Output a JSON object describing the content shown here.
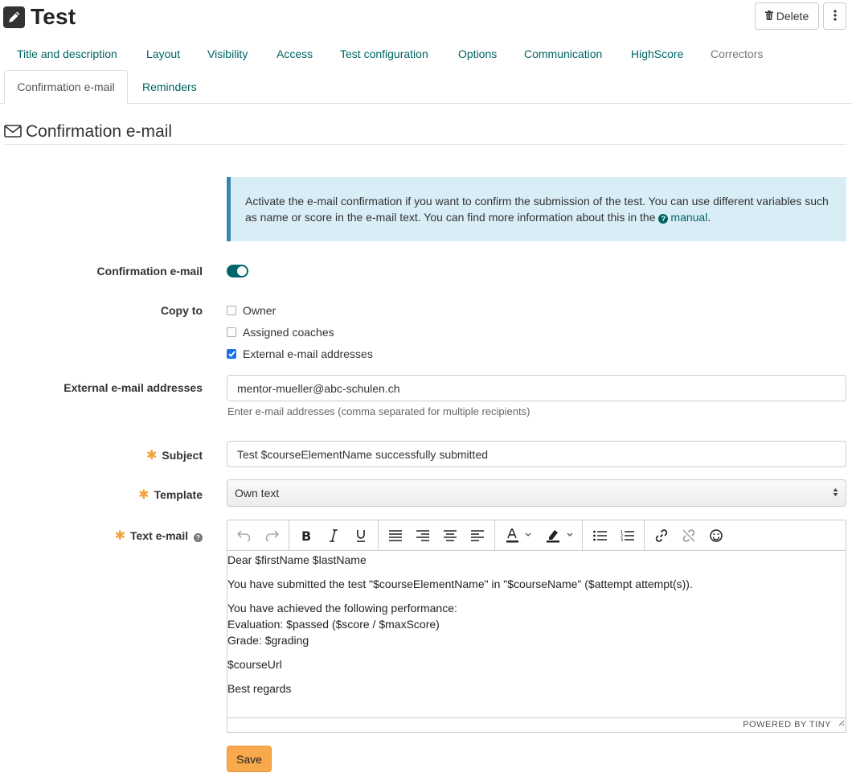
{
  "header": {
    "title": "Test",
    "delete_label": "Delete"
  },
  "tabs": [
    {
      "label": "Title and description",
      "state": "link"
    },
    {
      "label": "Layout",
      "state": "link"
    },
    {
      "label": "Visibility",
      "state": "link"
    },
    {
      "label": "Access",
      "state": "link"
    },
    {
      "label": "Test configuration",
      "state": "link"
    },
    {
      "label": "Options",
      "state": "link"
    },
    {
      "label": "Communication",
      "state": "link"
    },
    {
      "label": "HighScore",
      "state": "link"
    },
    {
      "label": "Correctors",
      "state": "disabled"
    },
    {
      "label": "Confirmation e-mail",
      "state": "active"
    },
    {
      "label": "Reminders",
      "state": "link"
    }
  ],
  "section": {
    "title": "Confirmation e-mail"
  },
  "info": {
    "text_before": "Activate the e-mail confirmation if you want to confirm the submission of the test. You can use different variables such as name or score in the e-mail text. You can find more information about this in the",
    "link": "manual",
    "text_after": "."
  },
  "form": {
    "confirmation_label": "Confirmation e-mail",
    "confirmation_enabled": true,
    "copy_to_label": "Copy to",
    "copy_to_options": [
      {
        "label": "Owner",
        "checked": false
      },
      {
        "label": "Assigned coaches",
        "checked": false
      },
      {
        "label": "External e-mail addresses",
        "checked": true
      }
    ],
    "external_label": "External e-mail addresses",
    "external_value": "mentor-mueller@abc-schulen.ch",
    "external_help": "Enter e-mail addresses (comma separated for multiple recipients)",
    "subject_label": "Subject",
    "subject_value": "Test $courseElementName successfully submitted",
    "template_label": "Template",
    "template_value": "Own text",
    "text_label": "Text e-mail",
    "required_marker": "✱",
    "save_label": "Save"
  },
  "editor": {
    "lines": [
      "Dear $firstName $lastName",
      "You have submitted the test \"$courseElementName\" in \"$courseName\" ($attempt attempt(s)).",
      "You have achieved the following performance:",
      "Evaluation: $passed ($score / $maxScore)",
      "Grade: $grading",
      "$courseUrl",
      "Best regards"
    ],
    "powered_by": "POWERED BY TINY"
  },
  "colors": {
    "accent": "#006363",
    "toggle_on": "#00666a",
    "info_bg": "#d9edf7",
    "info_border": "#3a87ad",
    "required": "#f0a33b",
    "save_button": "#f7a94b",
    "checkbox_checked": "#1a73e8"
  }
}
